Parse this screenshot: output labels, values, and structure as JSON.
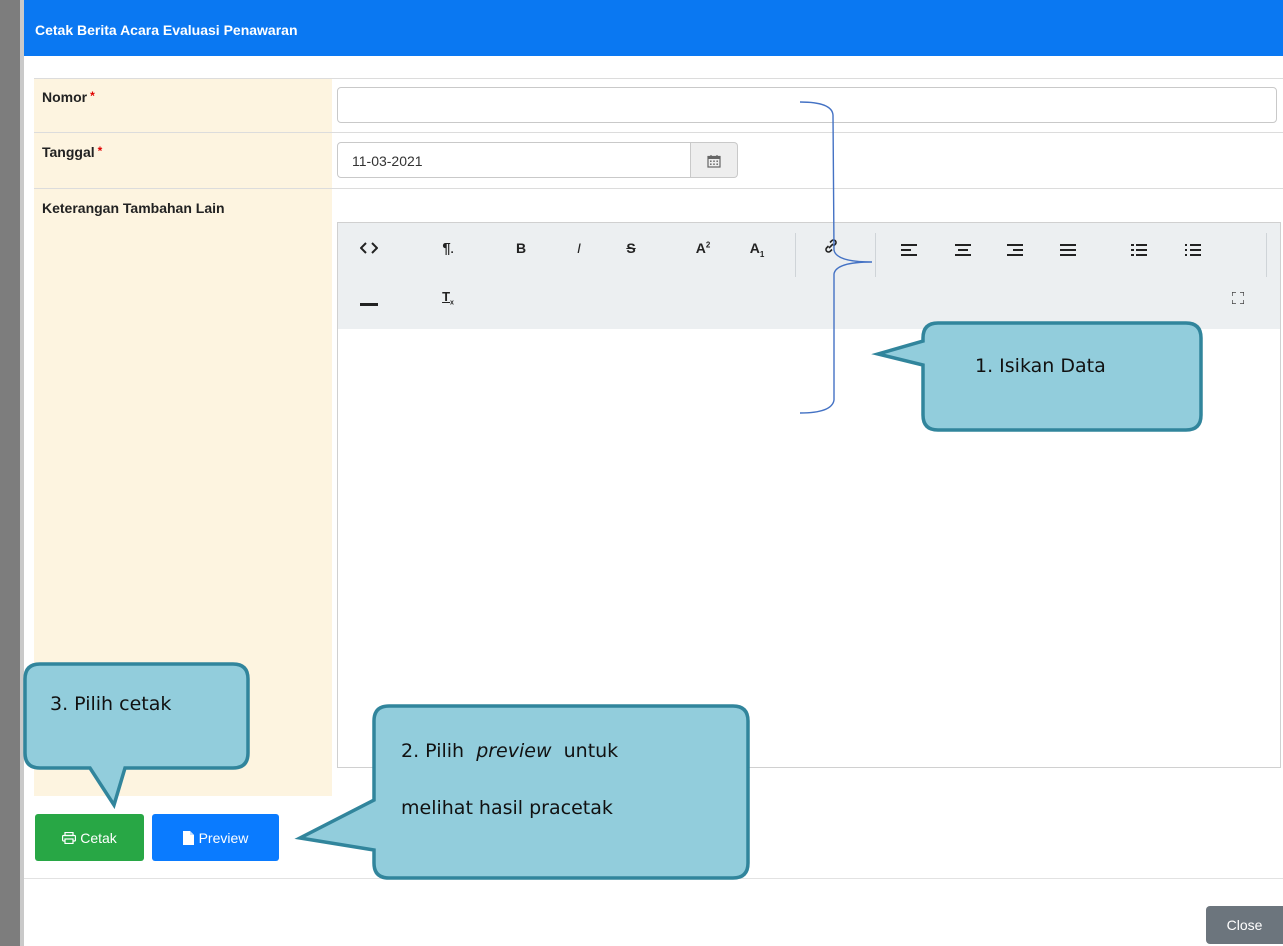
{
  "modal": {
    "title": "Cetak Berita Acara Evaluasi Penawaran"
  },
  "form": {
    "nomor_label": "Nomor",
    "nomor_value": "",
    "tanggal_label": "Tanggal",
    "tanggal_value": "11-03-2021",
    "required_mark": "*",
    "keterangan_label": "Keterangan Tambahan Lain",
    "editor_content": ""
  },
  "editor_toolbar": {
    "row1": [
      {
        "name": "code-view-icon",
        "glyph": "<>"
      },
      {
        "name": "paragraph-style-icon",
        "glyph": "¶"
      },
      {
        "name": "bold-icon",
        "glyph": "B"
      },
      {
        "name": "italic-icon",
        "glyph": "I"
      },
      {
        "name": "strikethrough-icon",
        "glyph": "S"
      },
      {
        "name": "superscript-icon",
        "glyph": "A²"
      },
      {
        "name": "subscript-icon",
        "glyph": "A₁"
      },
      {
        "name": "link-icon",
        "glyph": "🔗"
      },
      {
        "name": "align-left-icon",
        "glyph": "≡"
      },
      {
        "name": "align-center-icon",
        "glyph": "≡"
      },
      {
        "name": "align-right-icon",
        "glyph": "≡"
      },
      {
        "name": "align-justify-icon",
        "glyph": "≡"
      },
      {
        "name": "bulleted-list-icon",
        "glyph": "☰"
      },
      {
        "name": "numbered-list-icon",
        "glyph": "☰"
      }
    ],
    "row2": [
      {
        "name": "horizontal-rule-icon",
        "glyph": "—"
      },
      {
        "name": "clear-formatting-icon",
        "glyph": "T"
      },
      {
        "name": "fullscreen-icon",
        "glyph": "⛶"
      }
    ]
  },
  "buttons": {
    "cetak": "Cetak",
    "preview": "Preview",
    "close": "Close"
  },
  "callouts": {
    "c1": "1.   Isikan Data",
    "c2_prefix": "2.  Pilih",
    "c2_em": "preview",
    "c2_suffix": "untuk",
    "c2_line2": "melihat hasil pracetak",
    "c3": "3. Pilih cetak"
  },
  "colors": {
    "header": "#0a78f2",
    "label_bg": "#fdf4e0",
    "cetak": "#28a745",
    "preview": "#0a7bff",
    "close": "#6c757d",
    "callout_fill": "#92cddc",
    "callout_stroke": "#31859c",
    "bracket": "#4472c4"
  }
}
